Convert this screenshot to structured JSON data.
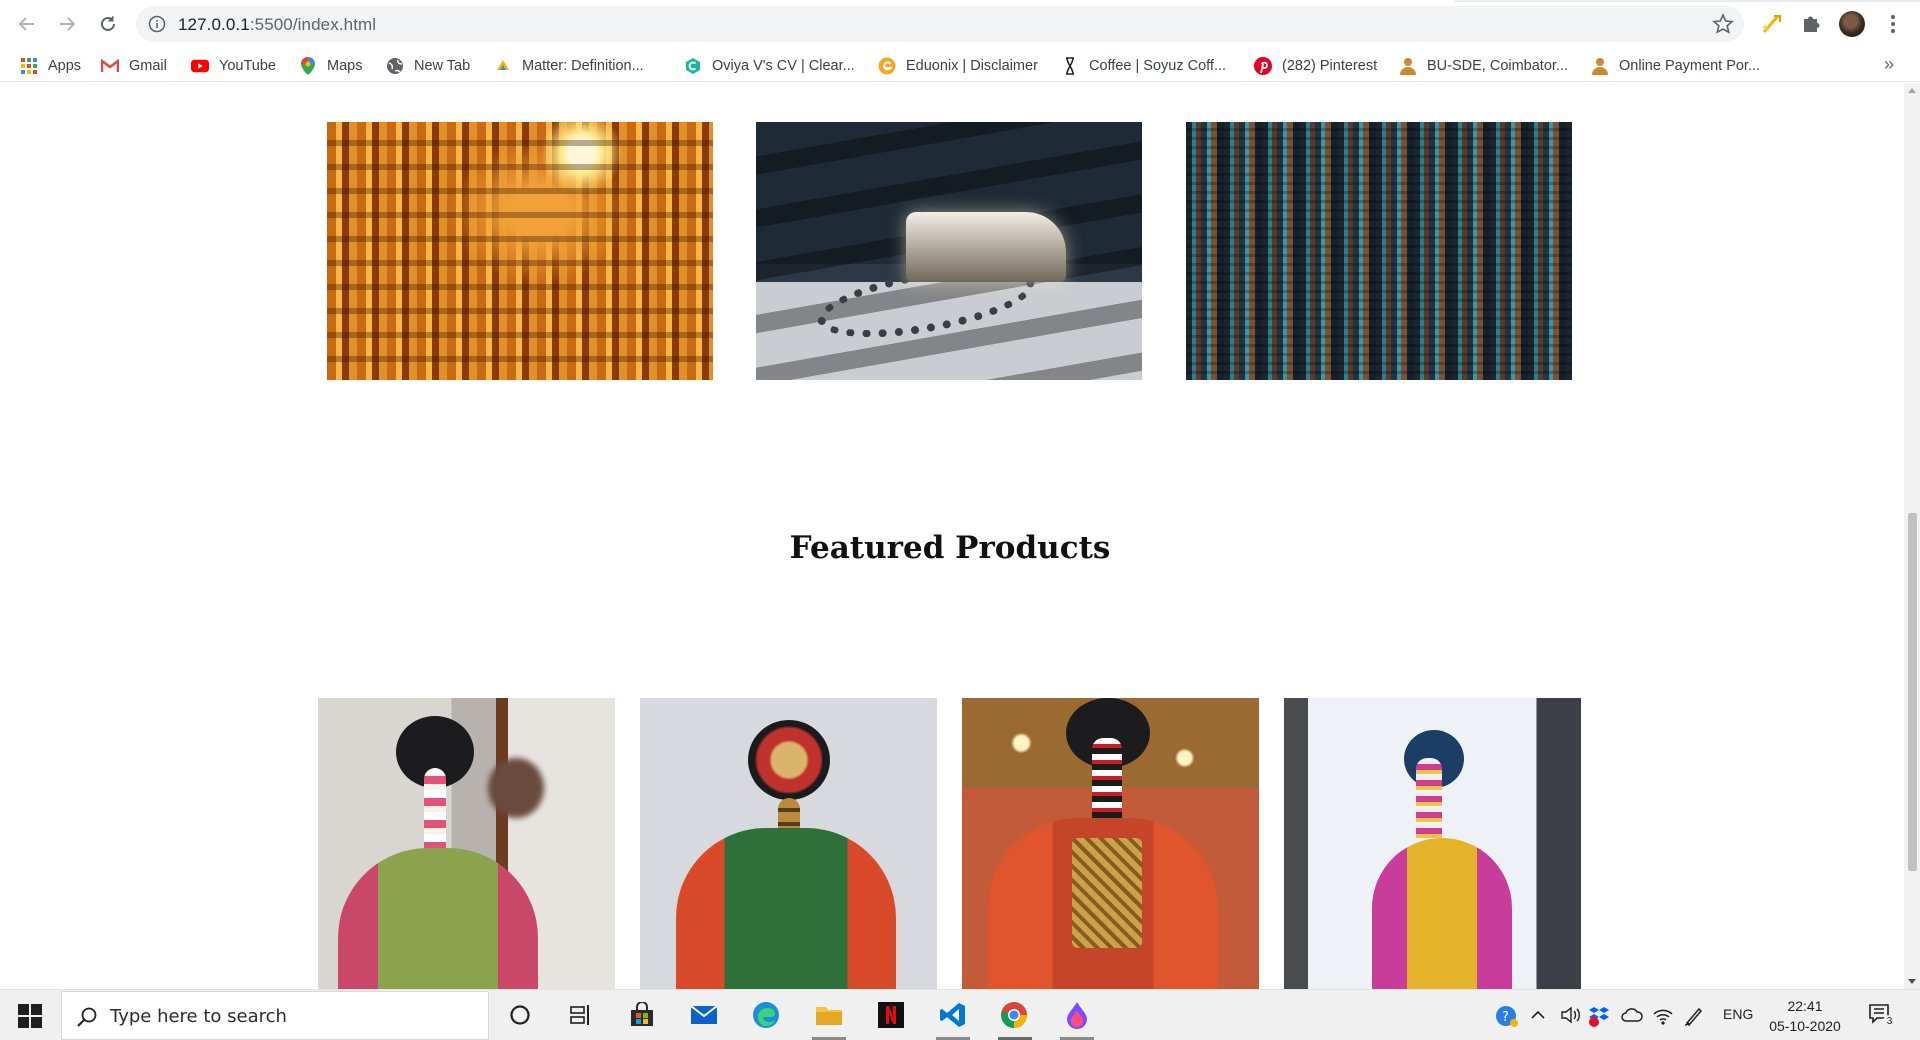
{
  "browser": {
    "url_host": "127.0.0.1",
    "url_rest": ":5500/index.html",
    "bookmarks": [
      {
        "label": "Apps",
        "icon": "apps-grid-icon"
      },
      {
        "label": "Gmail",
        "icon": "gmail-icon"
      },
      {
        "label": "YouTube",
        "icon": "youtube-icon"
      },
      {
        "label": "Maps",
        "icon": "maps-icon"
      },
      {
        "label": "New Tab",
        "icon": "globe-icon"
      },
      {
        "label": "Matter: Definition...",
        "icon": "matter-icon"
      },
      {
        "label": "Oviya V's CV | Clear...",
        "icon": "cv-icon"
      },
      {
        "label": "Eduonix | Disclaimer",
        "icon": "eduonix-icon"
      },
      {
        "label": "Coffee | Soyuz Coff...",
        "icon": "coffee-icon"
      },
      {
        "label": "(282) Pinterest",
        "icon": "pinterest-icon"
      },
      {
        "label": "BU-SDE, Coimbator...",
        "icon": "user-icon"
      },
      {
        "label": "Online Payment Por...",
        "icon": "user-icon"
      }
    ],
    "more_bookmarks": "»"
  },
  "page": {
    "featured_title": "Featured Products"
  },
  "taskbar": {
    "search_placeholder": "Type here to search",
    "language": "ENG",
    "time": "22:41",
    "date": "05-10-2020",
    "notification_count": "3"
  },
  "colors": {
    "accent_youtube": "#ff0000",
    "accent_pinterest": "#e60023",
    "vscode_blue": "#0078d4"
  }
}
